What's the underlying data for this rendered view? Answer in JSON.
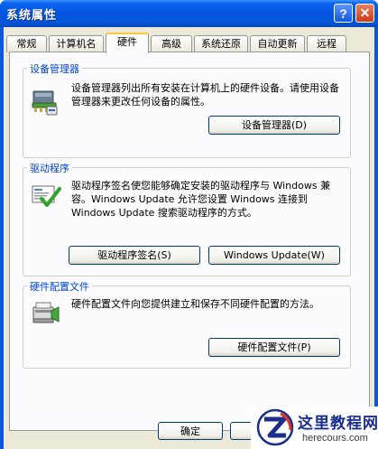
{
  "window": {
    "title": "系统属性",
    "help_glyph": "?",
    "close_glyph": "✕"
  },
  "tabs": [
    {
      "label": "常规"
    },
    {
      "label": "计算机名"
    },
    {
      "label": "硬件"
    },
    {
      "label": "高级"
    },
    {
      "label": "系统还原"
    },
    {
      "label": "自动更新"
    },
    {
      "label": "远程"
    }
  ],
  "active_tab": "硬件",
  "groups": {
    "device_manager": {
      "title": "设备管理器",
      "description": "设备管理器列出所有安装在计算机上的硬件设备。请使用设备管理器来更改任何设备的属性。",
      "button_label": "设备管理器(D)",
      "icon": "device-manager-icon"
    },
    "drivers": {
      "title": "驱动程序",
      "description": "驱动程序签名使您能够确定安装的驱动程序与 Windows 兼容。Windows Update 允许您设置 Windows 连接到 Windows Update 搜索驱动程序的方式。",
      "signing_button_label": "驱动程序签名(S)",
      "update_button_label": "Windows Update(W)",
      "icon": "driver-signing-icon"
    },
    "hardware_profiles": {
      "title": "硬件配置文件",
      "description": "硬件配置文件向您提供建立和保存不同硬件配置的方法。",
      "button_label": "硬件配置文件(P)",
      "icon": "hardware-profile-icon"
    }
  },
  "footer": {
    "ok_label": "确定"
  },
  "watermark": {
    "title": "这里教程网",
    "url": "herecours.com"
  },
  "colors": {
    "titlebar": "#0553e0",
    "group_title": "#0046d5",
    "client": "#ece9d8",
    "watermark_title": "#1a2f8c"
  }
}
